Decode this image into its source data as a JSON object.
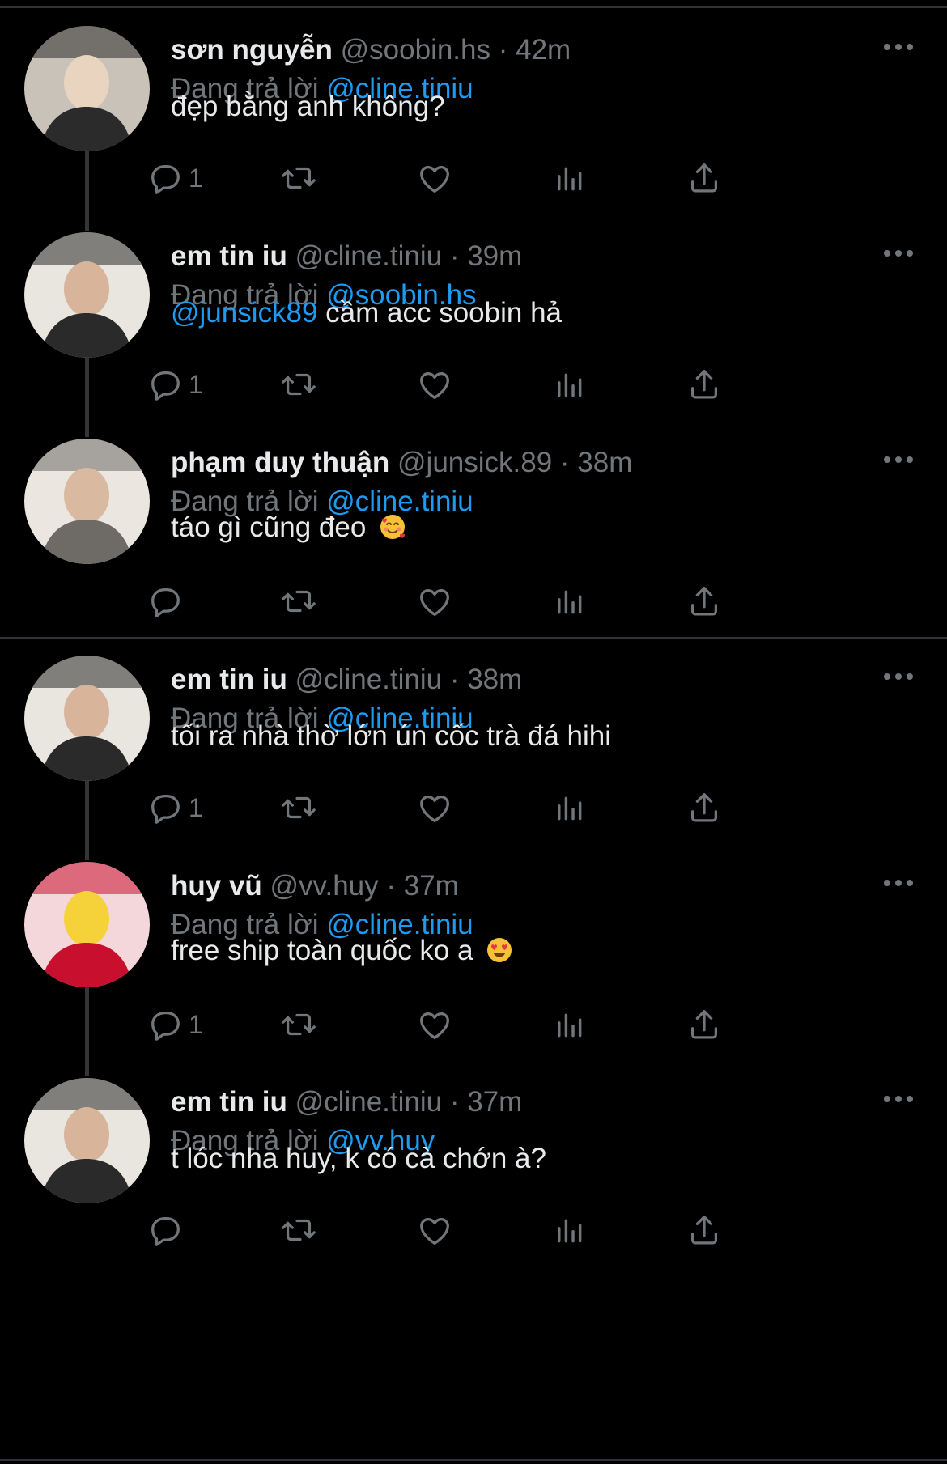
{
  "replying_prefix": "Đang trả lời",
  "tweets": [
    {
      "name": "sơn nguyễn",
      "handle": "@soobin.hs",
      "time": "42m",
      "reply_to": "@cline.tiniu",
      "text_mention": "",
      "text": "đẹp bằng anh không?",
      "emoji": "",
      "reply_count": "1",
      "avatar_colors": [
        "#c9c2b8",
        "#2b2b2b",
        "#e8d4bf"
      ]
    },
    {
      "name": "em tin iu",
      "handle": "@cline.tiniu",
      "time": "39m",
      "reply_to": "@soobin.hs",
      "text_mention": "@junsick89",
      "text": " cầm acc soobin hả",
      "emoji": "",
      "reply_count": "1",
      "avatar_colors": [
        "#e9e6df",
        "#2a2a2a",
        "#d8b49b"
      ]
    },
    {
      "name": "phạm duy thuận",
      "handle": "@junsick.89",
      "time": "38m",
      "reply_to": "@cline.tiniu",
      "text_mention": "",
      "text": "táo gì cũng đeo ",
      "emoji": "smiling-face-with-hearts",
      "reply_count": "",
      "avatar_colors": [
        "#ebe6e0",
        "#6e6a66",
        "#d9b9a0"
      ]
    },
    {
      "name": "em tin iu",
      "handle": "@cline.tiniu",
      "time": "38m",
      "reply_to": "@cline.tiniu",
      "text_mention": "",
      "text": "tối ra nhà thờ lớn ún cốc trà đá hihi",
      "emoji": "",
      "reply_count": "1",
      "avatar_colors": [
        "#e9e6df",
        "#2a2a2a",
        "#d8b49b"
      ]
    },
    {
      "name": "huy vũ",
      "handle": "@vv.huy",
      "time": "37m",
      "reply_to": "@cline.tiniu",
      "text_mention": "",
      "text": "free ship toàn quốc ko a ",
      "emoji": "heart-eyes",
      "reply_count": "1",
      "avatar_colors": [
        "#f3d7db",
        "#c8102e",
        "#f5d23a"
      ]
    },
    {
      "name": "em tin iu",
      "handle": "@cline.tiniu",
      "time": "37m",
      "reply_to": "@vv.huy",
      "text_mention": "",
      "text": "t lóc nha huy, k có cà chớn à?",
      "emoji": "",
      "reply_count": "",
      "avatar_colors": [
        "#e9e6df",
        "#2a2a2a",
        "#d8b49b"
      ]
    }
  ],
  "colors": {
    "background": "#000000",
    "primary_text": "#e7e9ea",
    "secondary_text": "#71767b",
    "mention": "#1d9bf0",
    "divider": "#2f3336"
  },
  "icons": [
    "reply-icon",
    "retweet-icon",
    "like-icon",
    "views-icon",
    "share-icon",
    "more-icon"
  ]
}
